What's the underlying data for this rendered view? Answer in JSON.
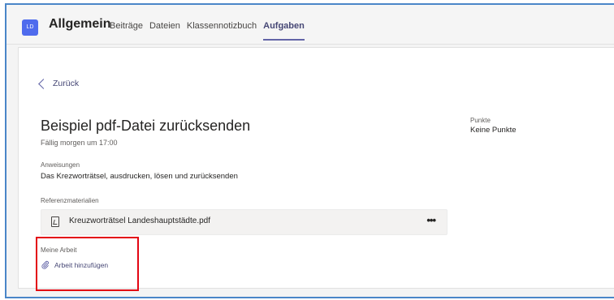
{
  "header": {
    "team_initials": "LD",
    "channel_name": "Allgemein",
    "tabs": [
      {
        "label": "Beiträge"
      },
      {
        "label": "Dateien"
      },
      {
        "label": "Klassennotizbuch"
      },
      {
        "label": "Aufgaben",
        "active": true
      }
    ]
  },
  "assignment": {
    "back_label": "Zurück",
    "title": "Beispiel pdf-Datei zurücksenden",
    "due": "Fällig morgen um 17:00",
    "instructions_label": "Anweisungen",
    "instructions_text": "Das Krezworträtsel, ausdrucken, lösen und zurücksenden",
    "reference_label": "Referenzmaterialien",
    "reference_file": "Kreuzworträtsel Landeshauptstädte.pdf",
    "more_label": "•••",
    "my_work_label": "Meine Arbeit",
    "add_work_label": "Arbeit hinzufügen"
  },
  "points": {
    "label": "Punkte",
    "value": "Keine Punkte"
  },
  "colors": {
    "accent": "#6264a7",
    "highlight_border": "#e30613",
    "frame_border": "#4a86c8"
  }
}
